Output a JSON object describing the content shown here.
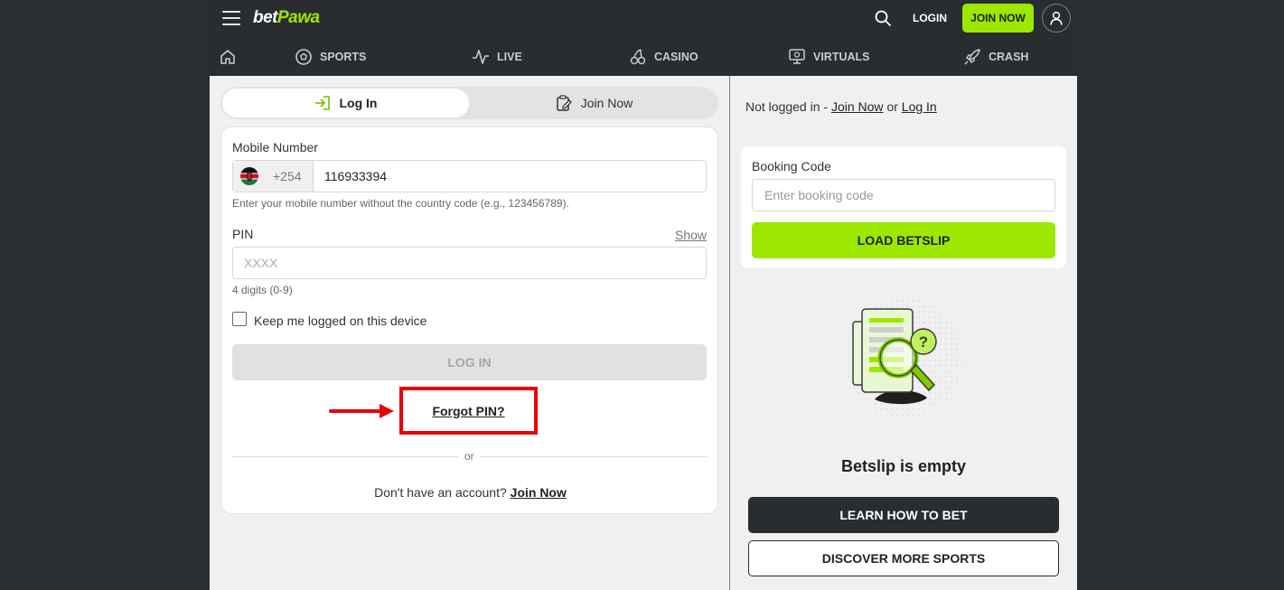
{
  "header": {
    "logo_part1": "bet",
    "logo_part2": "Pawa",
    "login_label": "LOGIN",
    "join_label": "JOIN NOW"
  },
  "nav": {
    "items": [
      {
        "label": "SPORTS",
        "icon": "soccer-ball-icon"
      },
      {
        "label": "LIVE",
        "icon": "pulse-icon"
      },
      {
        "label": "CASINO",
        "icon": "cherries-icon"
      },
      {
        "label": "VIRTUALS",
        "icon": "virtual-screen-icon"
      },
      {
        "label": "CRASH",
        "icon": "rocket-icon"
      }
    ]
  },
  "auth_tabs": {
    "login": "Log In",
    "join": "Join Now"
  },
  "form": {
    "mobile_label": "Mobile Number",
    "country_code": "+254",
    "mobile_value": "116933394",
    "mobile_hint": "Enter your mobile number without the country code (e.g., 123456789).",
    "pin_label": "PIN",
    "pin_show": "Show",
    "pin_placeholder": "XXXX",
    "pin_hint": "4 digits (0-9)",
    "keep_logged": "Keep me logged on this device",
    "login_button": "LOG IN",
    "forgot_pin": "Forgot PIN?",
    "or": "or",
    "no_account": "Don't have an account?",
    "join_now": "Join Now"
  },
  "betslip": {
    "status_prefix": "Not logged in -",
    "status_join": "Join Now",
    "status_or": "or",
    "status_login": "Log In",
    "booking_title": "Booking Code",
    "booking_placeholder": "Enter booking code",
    "load_button": "LOAD BETSLIP",
    "empty_title": "Betslip is empty",
    "learn_button": "LEARN HOW TO BET",
    "discover_button": "DISCOVER MORE SPORTS"
  },
  "colors": {
    "brand_green": "#9ce800",
    "header_dark": "#2a2d30",
    "highlight_red": "#e8000b"
  }
}
